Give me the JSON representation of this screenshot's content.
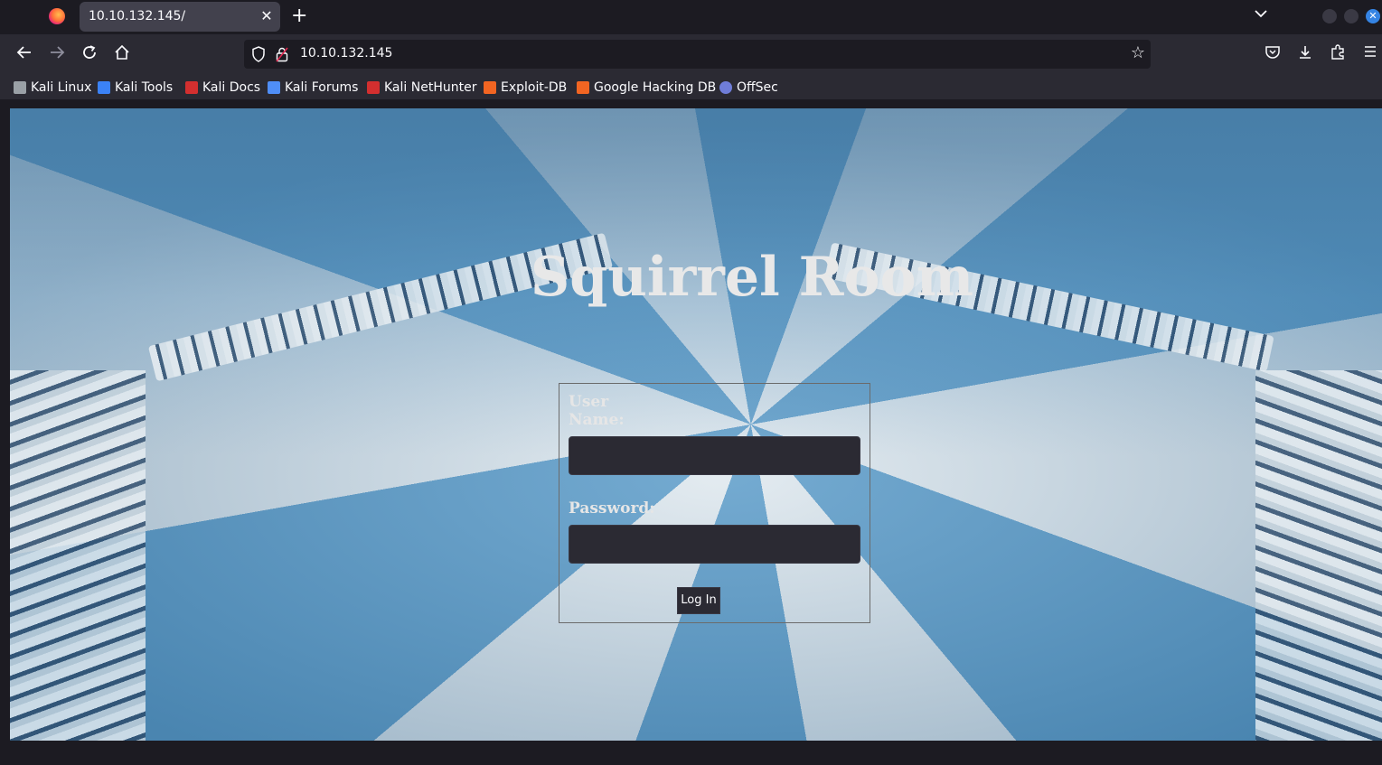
{
  "browser": {
    "tab": {
      "title": "10.10.132.145/"
    },
    "url": "10.10.132.145",
    "bookmarks": [
      {
        "label": "Kali Linux",
        "icon": "kali-dragon-icon",
        "color": "#9aa0a6"
      },
      {
        "label": "Kali Tools",
        "icon": "kali-tools-icon",
        "color": "#3b82f6"
      },
      {
        "label": "Kali Docs",
        "icon": "kali-docs-icon",
        "color": "#d32f2f"
      },
      {
        "label": "Kali Forums",
        "icon": "kali-forums-icon",
        "color": "#4f8ef7"
      },
      {
        "label": "Kali NetHunter",
        "icon": "kali-nethunter-icon",
        "color": "#d32f2f"
      },
      {
        "label": "Exploit-DB",
        "icon": "exploit-db-icon",
        "color": "#f26522"
      },
      {
        "label": "Google Hacking DB",
        "icon": "ghdb-icon",
        "color": "#f26522"
      },
      {
        "label": "OffSec",
        "icon": "offsec-icon",
        "color": "#6f7dd8"
      }
    ]
  },
  "page": {
    "title": "Squirrel Room",
    "form": {
      "username_label": "User Name:",
      "username_value": "",
      "password_label": "Password:",
      "password_value": "",
      "submit_label": "Log In"
    }
  },
  "colors": {
    "accent": "#3584e4",
    "toolbar": "#2b2a33",
    "tabstrip": "#1c1b22"
  }
}
